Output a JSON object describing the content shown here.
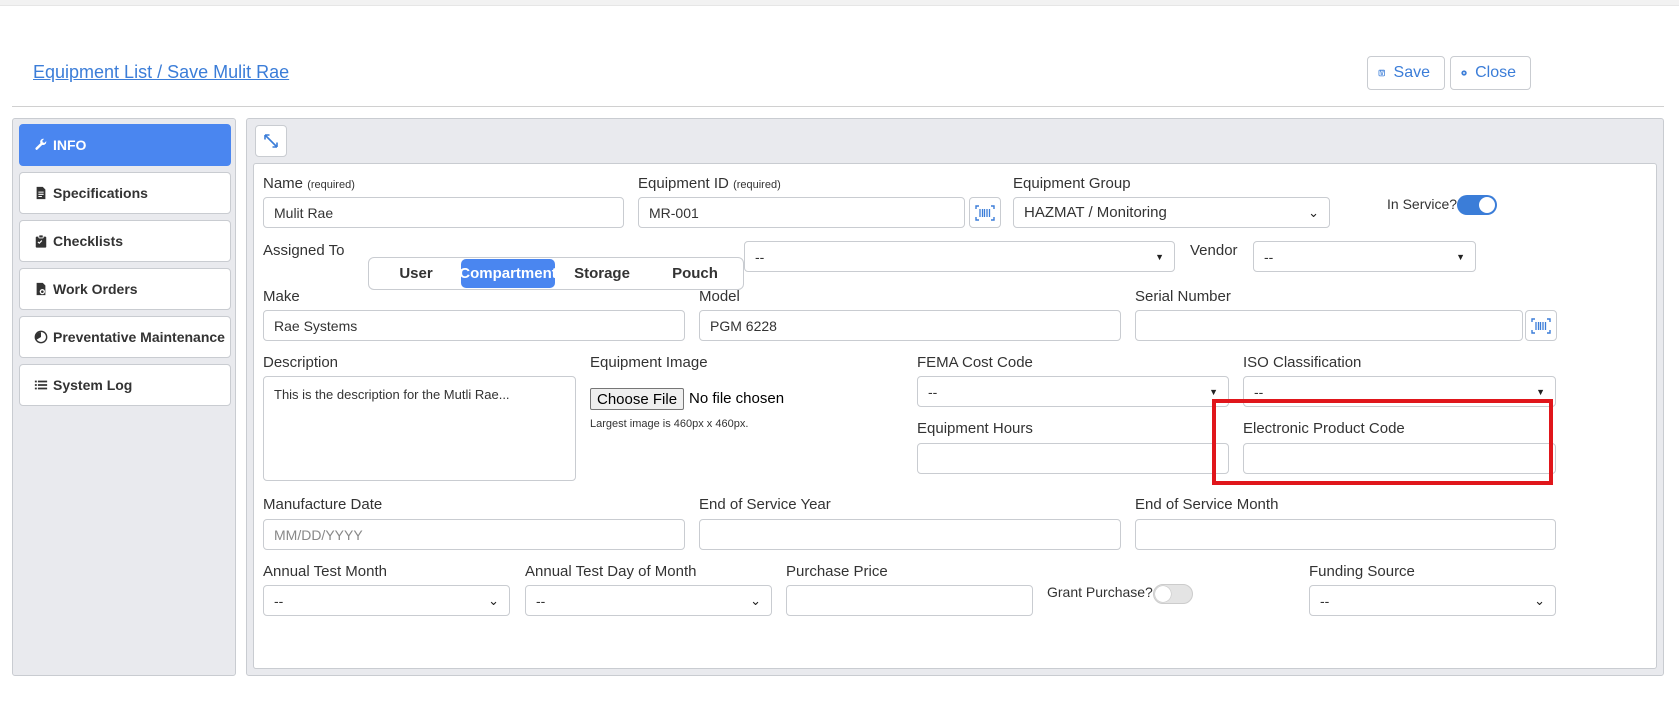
{
  "header": {
    "breadcrumb": "Equipment List / Save Mulit Rae",
    "save_label": "Save",
    "close_label": "Close"
  },
  "sidebar": {
    "items": [
      {
        "label": "INFO",
        "icon": "wrench-icon",
        "active": true
      },
      {
        "label": "Specifications",
        "icon": "document-icon"
      },
      {
        "label": "Checklists",
        "icon": "clipboard-icon"
      },
      {
        "label": "Work Orders",
        "icon": "file-gear-icon"
      },
      {
        "label": "Preventative Maintenance",
        "icon": "pie-chart-icon"
      },
      {
        "label": "System Log",
        "icon": "list-icon"
      }
    ]
  },
  "form": {
    "name": {
      "label": "Name",
      "required": "(required)",
      "value": "Mulit Rae"
    },
    "equipment_id": {
      "label": "Equipment ID",
      "required": "(required)",
      "value": "MR-001"
    },
    "equipment_group": {
      "label": "Equipment Group",
      "value": "HAZMAT / Monitoring"
    },
    "in_service": {
      "label": "In Service?",
      "on": true
    },
    "assigned_to": {
      "label": "Assigned To",
      "options": [
        "User",
        "Compartment",
        "Storage",
        "Pouch"
      ],
      "selected": "Compartment",
      "target_value": "--"
    },
    "vendor": {
      "label": "Vendor",
      "value": "--"
    },
    "make": {
      "label": "Make",
      "value": "Rae Systems"
    },
    "model": {
      "label": "Model",
      "value": "PGM 6228"
    },
    "serial_number": {
      "label": "Serial Number",
      "value": ""
    },
    "description": {
      "label": "Description",
      "value": "This is the description for the Mutli Rae..."
    },
    "equipment_image": {
      "label": "Equipment Image",
      "button": "Choose File",
      "status": "No file chosen",
      "hint": "Largest image is 460px x 460px."
    },
    "fema_cost_code": {
      "label": "FEMA Cost Code",
      "value": "--"
    },
    "iso_classification": {
      "label": "ISO Classification",
      "value": "--"
    },
    "equipment_hours": {
      "label": "Equipment Hours",
      "value": ""
    },
    "electronic_product_code": {
      "label": "Electronic Product Code",
      "value": ""
    },
    "manufacture_date": {
      "label": "Manufacture Date",
      "placeholder": "MM/DD/YYYY"
    },
    "end_of_service_year": {
      "label": "End of Service Year",
      "value": ""
    },
    "end_of_service_month": {
      "label": "End of Service Month",
      "value": ""
    },
    "annual_test_month": {
      "label": "Annual Test Month",
      "value": "--"
    },
    "annual_test_day": {
      "label": "Annual Test Day of Month",
      "value": "--"
    },
    "purchase_price": {
      "label": "Purchase Price",
      "value": ""
    },
    "grant_purchase": {
      "label": "Grant Purchase?",
      "on": false
    },
    "funding_source": {
      "label": "Funding Source",
      "value": "--"
    }
  },
  "colors": {
    "accent": "#4a86f0",
    "link": "#3b7dd8",
    "highlight": "#e0161b",
    "panel_bg": "#e9eaee"
  }
}
